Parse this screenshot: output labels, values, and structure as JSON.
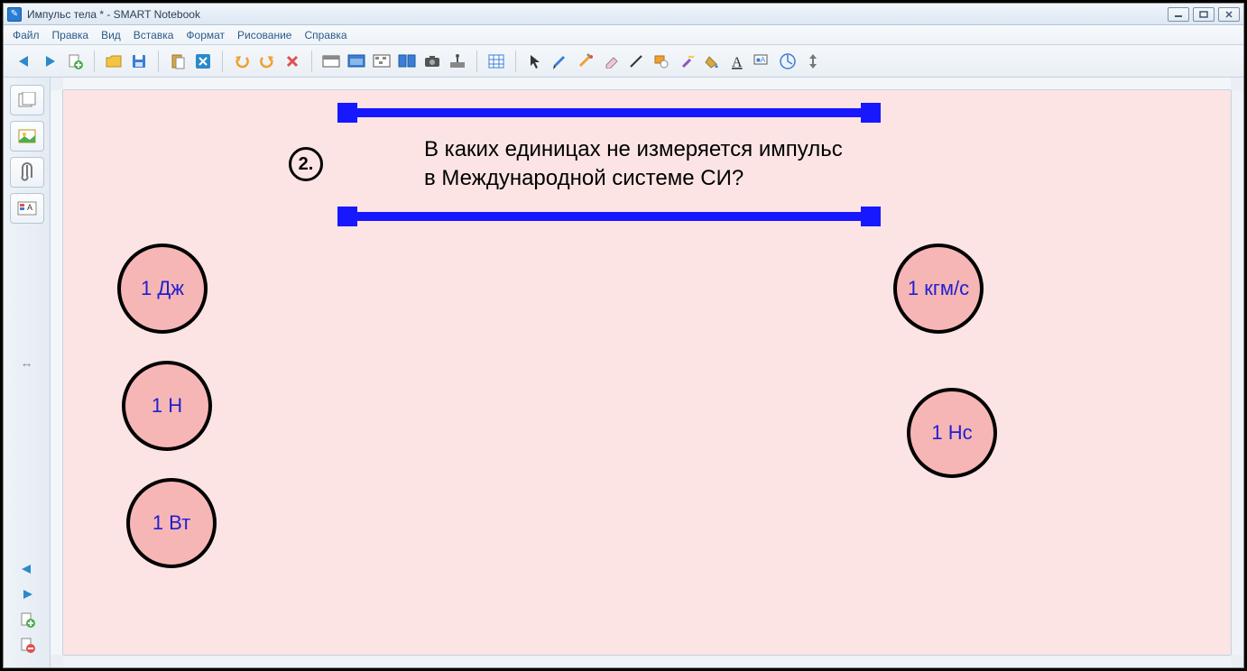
{
  "title": "Импульс тела * - SMART Notebook",
  "menu": {
    "file": "Файл",
    "edit": "Правка",
    "view": "Вид",
    "insert": "Вставка",
    "format": "Формат",
    "draw": "Рисование",
    "help": "Справка"
  },
  "question": {
    "number": "2.",
    "text": "В каких единицах не измеряется импульс в Международной системе СИ?"
  },
  "answers": {
    "a1": "1 Дж",
    "a2": "1 Н",
    "a3": "1 Вт",
    "a4": "1 кгм/с",
    "a5": "1 Нс"
  }
}
